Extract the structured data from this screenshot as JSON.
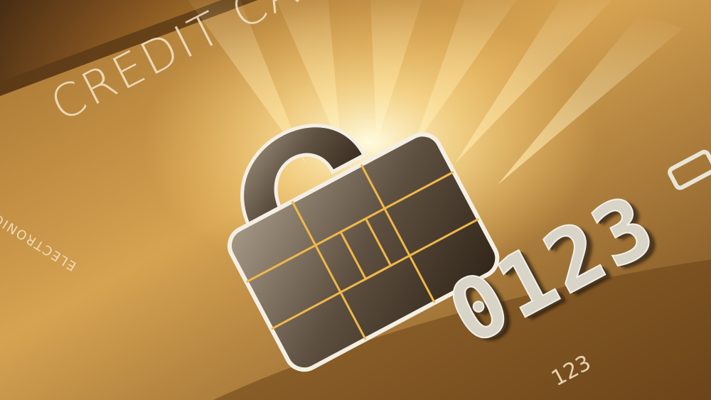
{
  "card": {
    "title": "CREDIT CARD",
    "use_label": "ELECTRONIC USE ONLY",
    "embossed_number": "0123",
    "small_number": "123"
  },
  "colors": {
    "gold_light": "#ffe9a6",
    "gold_mid": "#c8913a",
    "gold_dark": "#3a2410",
    "silver": "#d9d4c8"
  },
  "icons": {
    "chip": "padlock-chip-icon"
  }
}
